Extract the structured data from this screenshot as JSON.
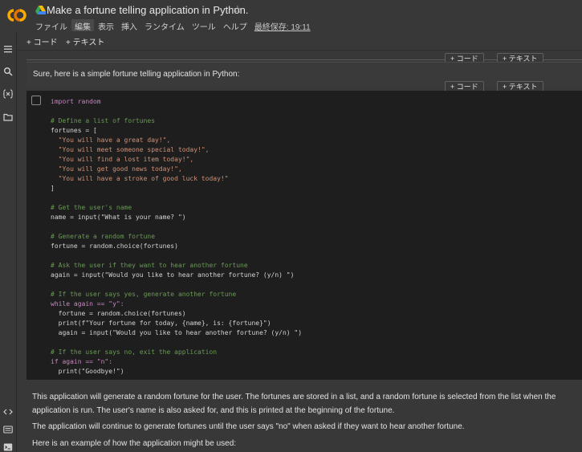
{
  "header": {
    "title": "Make a fortune telling application in Python.",
    "menu": [
      "ファイル",
      "編集",
      "表示",
      "挿入",
      "ランタイム",
      "ツール",
      "ヘルプ"
    ],
    "active_menu_index": 1,
    "last_saved": "最終保存: 19:11"
  },
  "toolbar": {
    "add_code": "+ コード",
    "add_text": "+ テキスト"
  },
  "cell_insert": {
    "code": "+ コード",
    "text": "+ テキスト"
  },
  "text_cell": {
    "text": "Sure, here is a simple fortune telling application in Python:"
  },
  "code_cell": {
    "lines": [
      "import random",
      "",
      "# Define a list of fortunes",
      "fortunes = [",
      "  \"You will have a great day!\",",
      "  \"You will meet someone special today!\",",
      "  \"You will find a lost item today!\",",
      "  \"You will get good news today!\",",
      "  \"You will have a stroke of good luck today!\"",
      "]",
      "",
      "# Get the user's name",
      "name = input(\"What is your name? \")",
      "",
      "# Generate a random fortune",
      "fortune = random.choice(fortunes)",
      "",
      "# Ask the user if they want to hear another fortune",
      "again = input(\"Would you like to hear another fortune? (y/n) \")",
      "",
      "# If the user says yes, generate another fortune",
      "while again == \"y\":",
      "  fortune = random.choice(fortunes)",
      "  print(f\"Your fortune for today, {name}, is: {fortune}\")",
      "  again = input(\"Would you like to hear another fortune? (y/n) \")",
      "",
      "# If the user says no, exit the application",
      "if again == \"n\":",
      "  print(\"Goodbye!\")"
    ]
  },
  "output": {
    "p1": "This application will generate a random fortune for the user. The fortunes are stored in a list, and a random fortune is selected from the list when the application is run. The user's name is also asked for, and this is printed at the beginning of the fortune.",
    "p2": "The application will continue to generate fortunes until the user says \"no\" when asked if they want to hear another fortune.",
    "p3": "Here is an example of how the application might be used:"
  },
  "colors": {
    "accent": "#f9ab00",
    "background": "#383838",
    "code_bg": "#1e1e1e"
  },
  "icons": [
    "colab-logo",
    "drive-icon",
    "star-icon",
    "menu-icon",
    "search-icon",
    "variables-icon",
    "folder-icon",
    "code-icon",
    "terminal-icon",
    "command-icon"
  ]
}
